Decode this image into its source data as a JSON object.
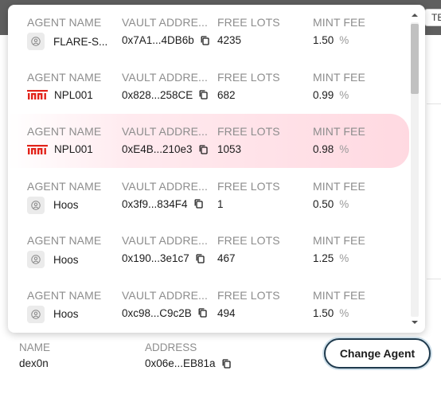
{
  "background": {
    "cut_text": "TBa"
  },
  "columns": {
    "agent_name": "AGENT NAME",
    "vault_address": "VAULT ADDRE...",
    "free_lots": "FREE LOTS",
    "mint_fee": "MINT FEE"
  },
  "agents": [
    {
      "name": "FLARE-S...",
      "icon": "user-avatar-icon",
      "vault": "0x7A1...4DB6b",
      "free_lots": "4235",
      "mint_fee": "1.50",
      "highlighted": false
    },
    {
      "name": "NPL001",
      "icon": "npl-logo-icon",
      "vault": "0x828...258CE",
      "free_lots": "682",
      "mint_fee": "0.99",
      "highlighted": false
    },
    {
      "name": "NPL001",
      "icon": "npl-logo-icon",
      "vault": "0xE4B...210e3",
      "free_lots": "1053",
      "mint_fee": "0.98",
      "highlighted": true
    },
    {
      "name": "Hoos",
      "icon": "user-avatar-icon",
      "vault": "0x3f9...834F4",
      "free_lots": "1",
      "mint_fee": "0.50",
      "highlighted": false
    },
    {
      "name": "Hoos",
      "icon": "user-avatar-icon",
      "vault": "0x190...3e1c7",
      "free_lots": "467",
      "mint_fee": "1.25",
      "highlighted": false
    },
    {
      "name": "Hoos",
      "icon": "user-avatar-icon",
      "vault": "0xc98...C9c2B",
      "free_lots": "494",
      "mint_fee": "1.50",
      "highlighted": false
    }
  ],
  "percent_symbol": "%",
  "selected": {
    "name_label": "NAME",
    "name": "dex0n",
    "address_label": "ADDRESS",
    "address": "0x06e...EB81a"
  },
  "change_button_label": "Change Agent",
  "colors": {
    "highlight": "#ffd9e1",
    "logo_red": "#e2231a",
    "button_border": "#1f3a4d"
  }
}
